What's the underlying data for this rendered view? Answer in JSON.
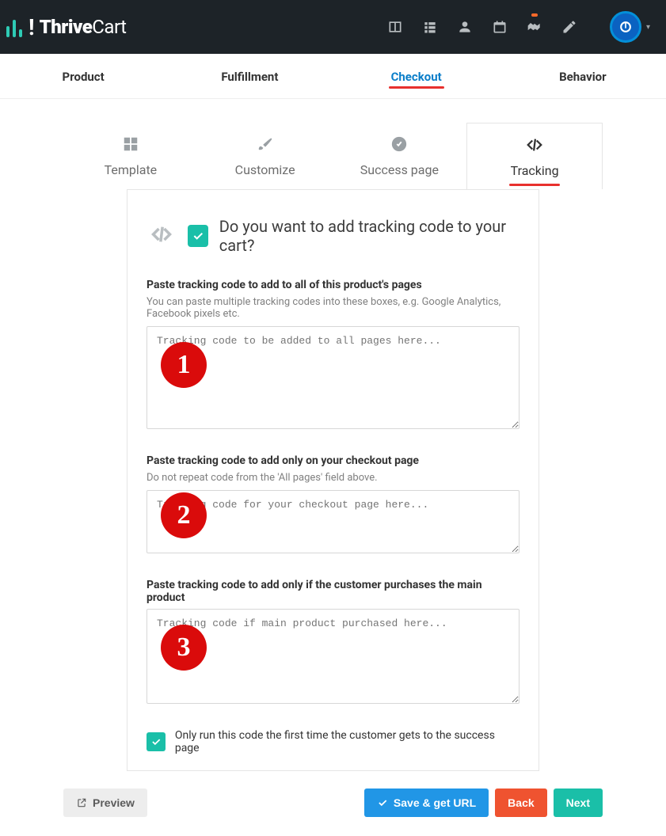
{
  "brand": {
    "name": "ThriveCart"
  },
  "header_icons": [
    "layout-icon",
    "list-icon",
    "user-icon",
    "calendar-icon",
    "handshake-icon",
    "edit-icon"
  ],
  "maintabs": [
    {
      "label": "Product",
      "active": false
    },
    {
      "label": "Fulfillment",
      "active": false
    },
    {
      "label": "Checkout",
      "active": true
    },
    {
      "label": "Behavior",
      "active": false
    }
  ],
  "subtabs": [
    {
      "label": "Template",
      "icon": "grid-icon",
      "active": false
    },
    {
      "label": "Customize",
      "icon": "brush-icon",
      "active": false
    },
    {
      "label": "Success page",
      "icon": "check-circle-icon",
      "active": false
    },
    {
      "label": "Tracking",
      "icon": "code-icon",
      "active": true
    }
  ],
  "panel": {
    "title": "Do you want to add tracking code to your cart?",
    "fields": {
      "all_pages": {
        "label": "Paste tracking code to add to all of this product's pages",
        "help": "You can paste multiple tracking codes into these boxes, e.g. Google Analytics, Facebook pixels etc.",
        "placeholder": "Tracking code to be added to all pages here...",
        "badge": "1"
      },
      "checkout_page": {
        "label": "Paste tracking code to add only on your checkout page",
        "help": "Do not repeat code from the 'All pages' field above.",
        "placeholder": "Tracking code for your checkout page here...",
        "badge": "2"
      },
      "main_product": {
        "label": "Paste tracking code to add only if the customer purchases the main product",
        "placeholder": "Tracking code if main product purchased here...",
        "badge": "3"
      }
    },
    "only_run_label": "Only run this code the first time the customer gets to the success page"
  },
  "footer": {
    "preview": "Preview",
    "save": "Save & get URL",
    "back": "Back",
    "next": "Next"
  }
}
